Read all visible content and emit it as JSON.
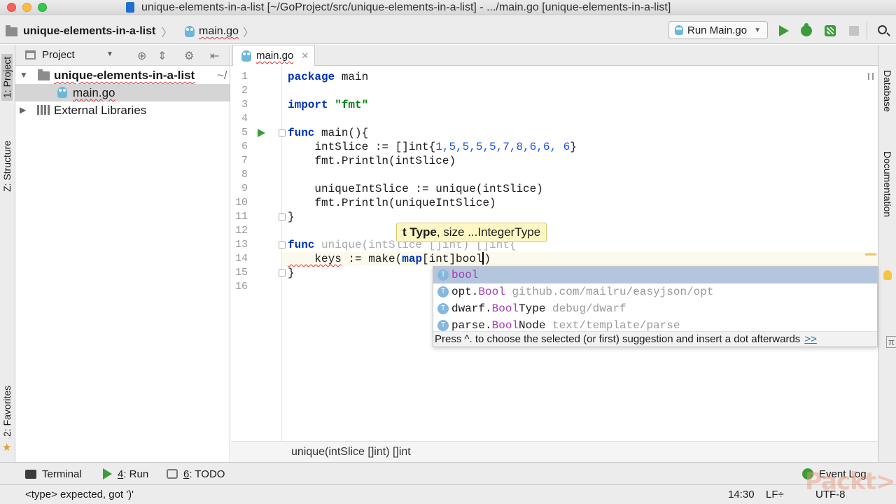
{
  "window": {
    "title": "unique-elements-in-a-list [~/GoProject/src/unique-elements-in-a-list] - .../main.go [unique-elements-in-a-list]"
  },
  "navbar": {
    "project": "unique-elements-in-a-list",
    "file": "main.go",
    "run_config": "Run Main.go"
  },
  "left_strip": {
    "project_tab": "1: Project",
    "structure_tab": "Z: Structure",
    "favorites_tab": "2: Favorites"
  },
  "right_strip": {
    "database_tab": "Database",
    "documentation_tab": "Documentation"
  },
  "project_panel": {
    "header": "Project",
    "tree": [
      {
        "label": "unique-elements-in-a-list",
        "suffix": "~/",
        "type": "folder",
        "expanded": true
      },
      {
        "label": "main.go",
        "type": "file",
        "selected": true
      },
      {
        "label": "External Libraries",
        "type": "libraries",
        "expanded": false
      }
    ]
  },
  "editor": {
    "tab": "main.go",
    "line_numbers": [
      "1",
      "2",
      "3",
      "4",
      "5",
      "6",
      "7",
      "8",
      "9",
      "10",
      "11",
      "12",
      "13",
      "14",
      "15",
      "16"
    ],
    "code": {
      "l1_kw": "package",
      "l1_rest": " main",
      "l3_kw": "import",
      "l3_str": "\"fmt\"",
      "l5_kw": "func",
      "l5_rest": " main(){",
      "l6_a": "    intSlice := []int{",
      "l6_nums": "1,5,5,5,5,7,8,6,6, 6",
      "l6_b": "}",
      "l7": "    fmt.Println(intSlice)",
      "l9": "    uniqueIntSlice := unique(intSlice)",
      "l10": "    fmt.Println(uniqueIntSlice)",
      "l11": "}",
      "l13_kw": "func",
      "l13_rest": " unique(intSlice []int) []int{",
      "l14_a": "    keys",
      "l14_b": " := make(",
      "l14_kw": "map",
      "l14_c": "[int]bool",
      "l14_d": ")",
      "l15": "}"
    },
    "param_hint": {
      "bold": "t Type",
      "rest": ", size ...IntegerType"
    },
    "completion": {
      "items": [
        {
          "prefix": "",
          "match": "bool",
          "suffix": "",
          "location": ""
        },
        {
          "prefix": "opt.",
          "match": "Bool",
          "suffix": "",
          "location": "github.com/mailru/easyjson/opt"
        },
        {
          "prefix": "dwarf.",
          "match": "Bool",
          "suffix": "Type",
          "location": "debug/dwarf"
        },
        {
          "prefix": "parse.",
          "match": "Bool",
          "suffix": "Node",
          "location": "text/template/parse"
        }
      ],
      "type_icon": "T",
      "footer": "Press ^. to choose the selected (or first) suggestion and insert a dot afterwards",
      "footer_link": ">>"
    },
    "breadcrumb": "unique(intSlice []int) []int"
  },
  "tool_windows": {
    "terminal": "Terminal",
    "run_num": "4",
    "run": ": Run",
    "todo_num": "6",
    "todo": ": TODO",
    "event_log": "Event Log"
  },
  "status_bar": {
    "message": "<type> expected, got ')'",
    "position": "14:30",
    "line_sep": "LF÷",
    "encoding": "UTF-8"
  },
  "watermark": "Packt>",
  "colors": {
    "keyword": "#0033b3",
    "string": "#067d17",
    "number": "#1750eb",
    "match": "#a63bb5",
    "selection": "#b3c6dd",
    "hint_bg": "#fff8c4"
  }
}
